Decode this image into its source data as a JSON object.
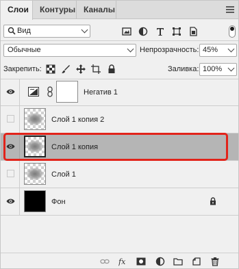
{
  "tabs": [
    {
      "label": "Слои",
      "active": true
    },
    {
      "label": "Контуры",
      "active": false
    },
    {
      "label": "Каналы",
      "active": false
    }
  ],
  "filter": {
    "label": "Вид",
    "icons": [
      "image-filter-icon",
      "adjustment-filter-icon",
      "type-filter-icon",
      "shape-filter-icon",
      "smart-object-filter-icon"
    ]
  },
  "blend": {
    "mode": "Обычные",
    "opacity_label": "Непрозрачность:",
    "opacity": "45%"
  },
  "lock": {
    "label": "Закрепить:",
    "fill_label": "Заливка:",
    "fill": "100%"
  },
  "layers": [
    {
      "name": "Негатив 1",
      "visible": true,
      "type": "adjustment"
    },
    {
      "name": "Слой 1 копия 2",
      "visible": false,
      "type": "pixel"
    },
    {
      "name": "Слой 1 копия",
      "visible": true,
      "type": "pixel",
      "selected": true
    },
    {
      "name": "Слой 1",
      "visible": false,
      "type": "pixel"
    },
    {
      "name": "Фон",
      "visible": true,
      "type": "background",
      "locked": true
    }
  ],
  "colors": {
    "highlight": "#e2231a",
    "selected_row": "#b5b5b5"
  },
  "bottom_icons": [
    "link-layers-icon",
    "fx-icon",
    "add-mask-icon",
    "new-adjustment-icon",
    "new-group-icon",
    "new-layer-icon",
    "delete-icon"
  ]
}
